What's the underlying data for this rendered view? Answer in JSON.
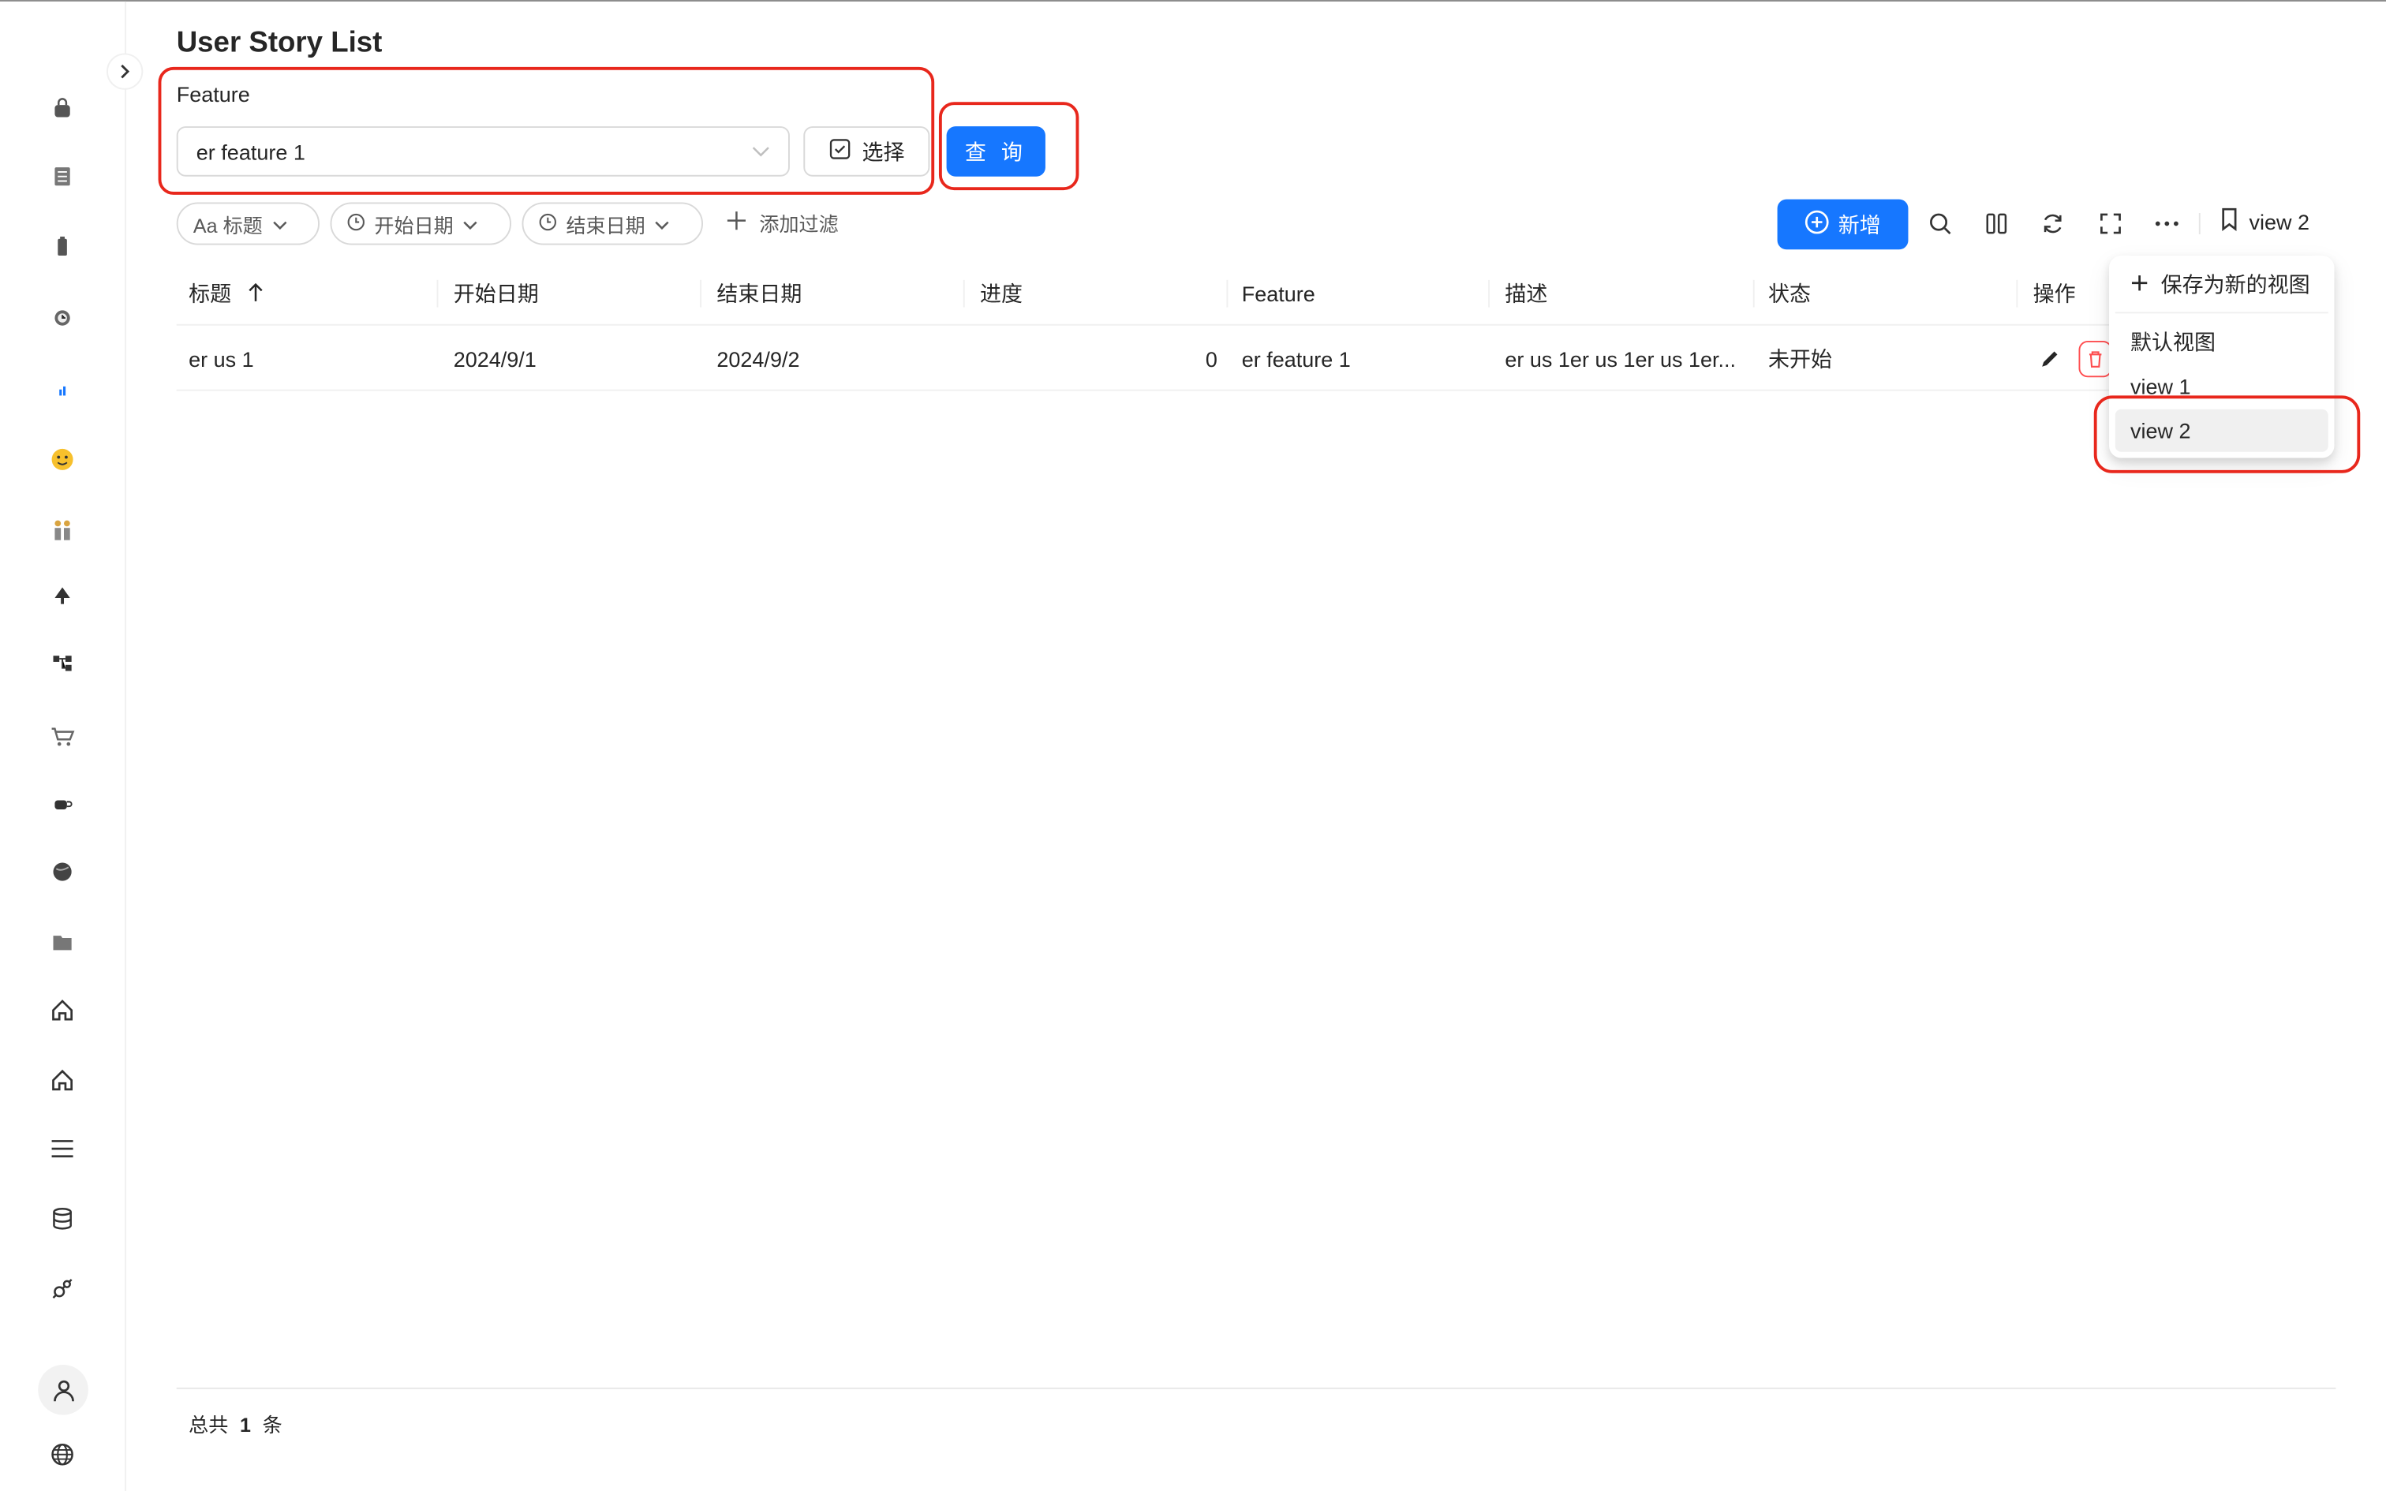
{
  "page": {
    "title": "User Story List"
  },
  "filters": {
    "feature_label": "Feature",
    "feature_value": "er feature 1",
    "pick_label": "选择",
    "query_label": "查 询"
  },
  "chips": [
    {
      "label": "Aa 标题"
    },
    {
      "label": "开始日期"
    },
    {
      "label": "结束日期"
    }
  ],
  "add_filter_label": "添加过滤",
  "toolbar": {
    "new_label": "新增",
    "current_view": "view 2"
  },
  "table": {
    "columns": [
      "标题",
      "开始日期",
      "结束日期",
      "进度",
      "Feature",
      "描述",
      "状态",
      "操作"
    ],
    "rows": [
      {
        "title": "er us 1",
        "start": "2024/9/1",
        "end": "2024/9/2",
        "progress": "0",
        "feature": "er feature 1",
        "desc": "er us 1er us 1er us 1er...",
        "status": "未开始"
      }
    ]
  },
  "view_menu": {
    "save_label": "保存为新的视图",
    "items": [
      "默认视图",
      "view 1",
      "view 2"
    ]
  },
  "footer": {
    "prefix": "总共",
    "count": "1",
    "suffix": "条"
  },
  "colors": {
    "primary": "#1677ff",
    "annotation": "#e8271c"
  }
}
